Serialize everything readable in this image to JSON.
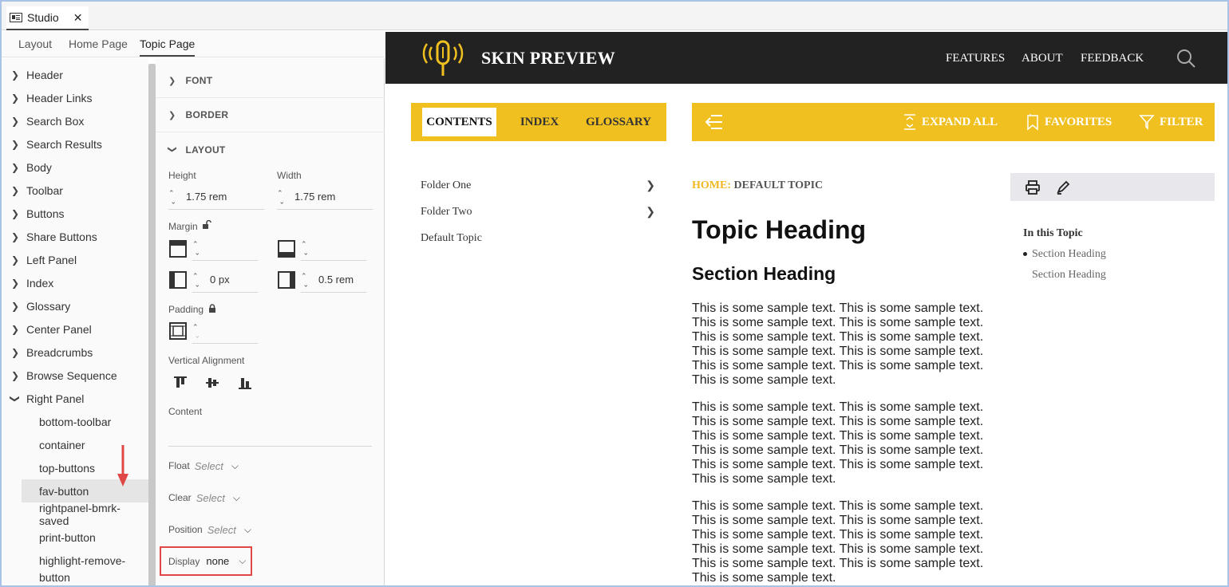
{
  "studio": {
    "tab_label": "Studio",
    "close_glyph": "✕"
  },
  "left_tabs": [
    "Layout",
    "Home Page",
    "Topic Page"
  ],
  "tree": {
    "items": [
      "Header",
      "Header Links",
      "Search Box",
      "Search Results",
      "Body",
      "Toolbar",
      "Buttons",
      "Share Buttons",
      "Left Panel",
      "Index",
      "Glossary",
      "Center Panel",
      "Breadcrumbs",
      "Browse Sequence",
      "Right Panel"
    ],
    "children": [
      "bottom-toolbar",
      "container",
      "top-buttons",
      "fav-button",
      "rightpanel-bmrk-saved",
      "print-button",
      "highlight-remove-",
      "button"
    ],
    "selected": "fav-button"
  },
  "props": {
    "font_label": "FONT",
    "border_label": "BORDER",
    "layout_label": "LAYOUT",
    "height_label": "Height",
    "height_value": "1.75 rem",
    "width_label": "Width",
    "width_value": "1.75 rem",
    "margin_label": "Margin",
    "margin_left": "0 px",
    "margin_right": "0.5 rem",
    "padding_label": "Padding",
    "valign_label": "Vertical Alignment",
    "content_label": "Content",
    "float_label": "Float",
    "clear_label": "Clear",
    "position_label": "Position",
    "select_placeholder": "Select",
    "display_label": "Display",
    "display_value": "none"
  },
  "preview": {
    "brand": "SKIN PREVIEW",
    "nav": [
      "FEATURES",
      "ABOUT",
      "FEEDBACK"
    ],
    "left_tabs": [
      "CONTENTS",
      "INDEX",
      "GLOSSARY"
    ],
    "toolbar": {
      "expand": "EXPAND ALL",
      "favorites": "FAVORITES",
      "filter": "FILTER"
    },
    "folders": [
      "Folder One",
      "Folder Two",
      "Default Topic"
    ],
    "breadcrumb_home": "HOME:",
    "breadcrumb_current": "DEFAULT TOPIC",
    "topic_heading": "Topic Heading",
    "section_heading": "Section Heading",
    "paragraph": "This is some sample text. This is some sample text. This is some sample text. This is some sample text. This is some sample text. This is some sample text. This is some sample text. This is some sample text. This is some sample text. This is some sample text. This is some sample text.",
    "toc_title": "In this Topic",
    "toc_items": [
      "Section Heading",
      "Section Heading"
    ]
  },
  "colors": {
    "accent_yellow": "#f0c020",
    "nav_dark": "#222222",
    "highlight_red": "#e04848"
  }
}
